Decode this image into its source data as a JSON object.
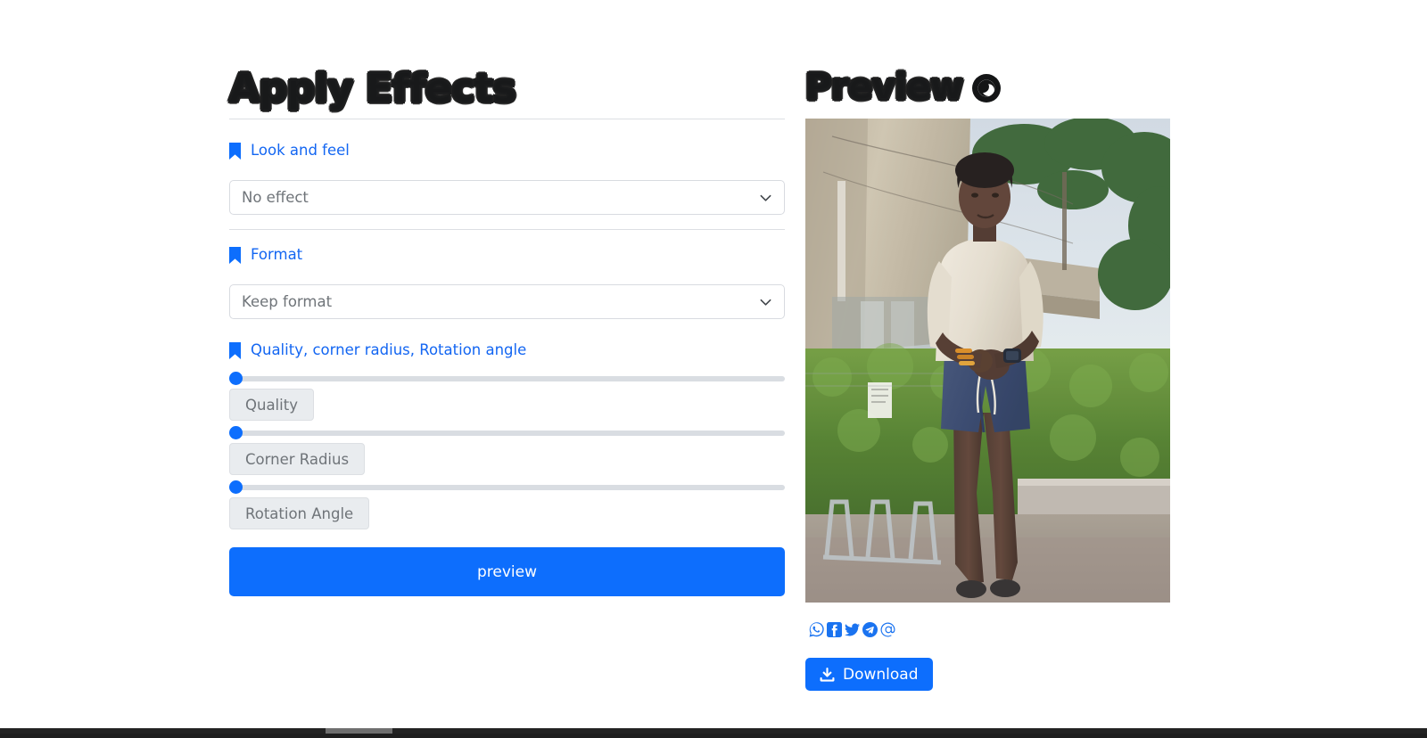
{
  "left_panel": {
    "title": "Apply Effects",
    "sections": [
      {
        "label": "Look and feel",
        "icon": "bookmark-icon",
        "control": "select",
        "selected": "No effect"
      },
      {
        "label": "Format",
        "icon": "bookmark-icon",
        "control": "select",
        "selected": "Keep format"
      },
      {
        "label": "Quality, corner radius, Rotation angle",
        "icon": "bookmark-icon",
        "control": "sliders"
      }
    ],
    "sliders": [
      {
        "name": "Quality",
        "value": 0,
        "min": 0,
        "max": 100,
        "percent": 0
      },
      {
        "name": "Corner Radius",
        "value": 0,
        "min": 0,
        "max": 100,
        "percent": 0
      },
      {
        "name": "Rotation Angle",
        "value": 0,
        "min": 0,
        "max": 360,
        "percent": 0
      }
    ],
    "preview_button": "preview"
  },
  "right_panel": {
    "title": "Preview",
    "title_icon": "eye-icon",
    "image_alt": "Person standing outdoors in front of a building with palm trees and a hedge",
    "share": [
      {
        "name": "whatsapp-share-icon",
        "label": "WhatsApp"
      },
      {
        "name": "facebook-share-icon",
        "label": "Facebook"
      },
      {
        "name": "twitter-share-icon",
        "label": "Twitter"
      },
      {
        "name": "telegram-share-icon",
        "label": "Telegram"
      },
      {
        "name": "email-share-icon",
        "label": "Email"
      }
    ],
    "download_button": "Download",
    "download_icon": "download-icon"
  },
  "colors": {
    "accent": "#0d6efd",
    "link": "#1366f2",
    "text_muted": "#6f7479",
    "border": "#d8dbe0",
    "track": "#d9dde2",
    "ghost_bg": "#e9ecef",
    "heading": "#18191a"
  }
}
